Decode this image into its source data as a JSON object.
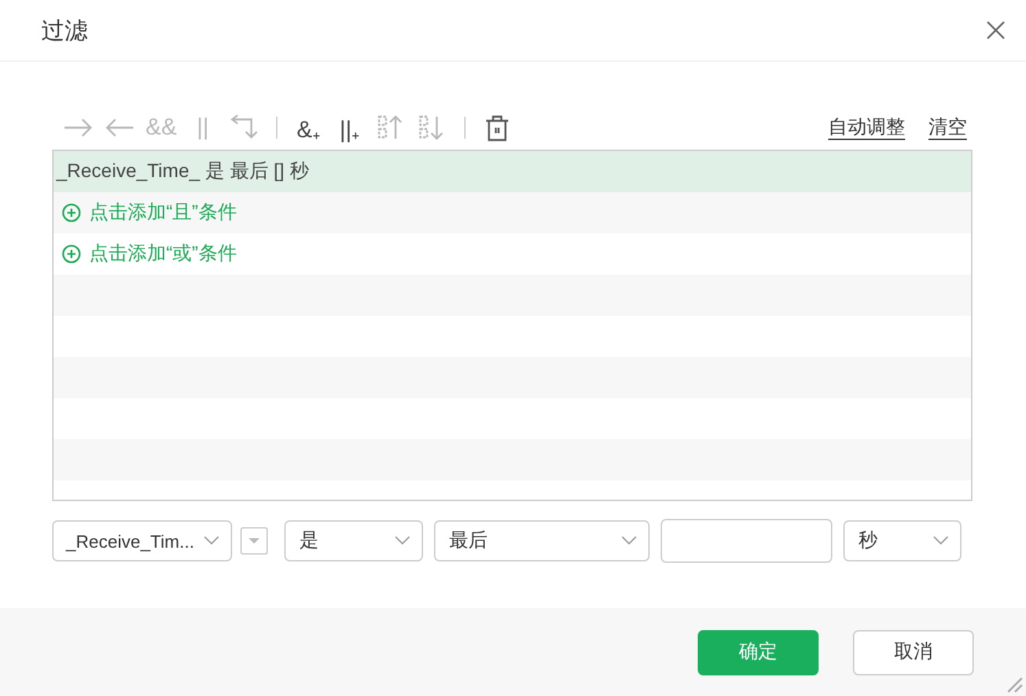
{
  "window": {
    "title": "过滤"
  },
  "toolbar": [
    {
      "kind": "indent",
      "disabled": true
    },
    {
      "kind": "outdent",
      "disabled": true
    },
    {
      "kind": "text",
      "label": "&&",
      "disabled": true
    },
    {
      "kind": "text",
      "label": "||",
      "disabled": true
    },
    {
      "kind": "swap",
      "disabled": true
    },
    {
      "kind": "divider"
    },
    {
      "kind": "text",
      "label": "&₊",
      "disabled": false
    },
    {
      "kind": "text",
      "label": "||₊",
      "disabled": false
    },
    {
      "kind": "up",
      "disabled": true
    },
    {
      "kind": "down",
      "disabled": true
    },
    {
      "kind": "divider"
    },
    {
      "kind": "delete",
      "disabled": false
    }
  ],
  "links": [
    "自动调整",
    "清空"
  ],
  "conditions": [
    {
      "kind": "condition",
      "text": "_Receive_Time_ 是 最后 [] 秒",
      "selected": true
    },
    {
      "kind": "add",
      "text": "点击添加“且”条件",
      "selected": false
    },
    {
      "kind": "add",
      "text": "点击添加“或”条件",
      "selected": false
    }
  ],
  "editor": {
    "field": "_Receive_Tim...",
    "operator": "是",
    "mode": "最后",
    "unit": "秒"
  },
  "buttons": [
    {
      "label": "确定",
      "kind": "primary"
    },
    {
      "label": "取消",
      "kind": "secondary"
    }
  ]
}
